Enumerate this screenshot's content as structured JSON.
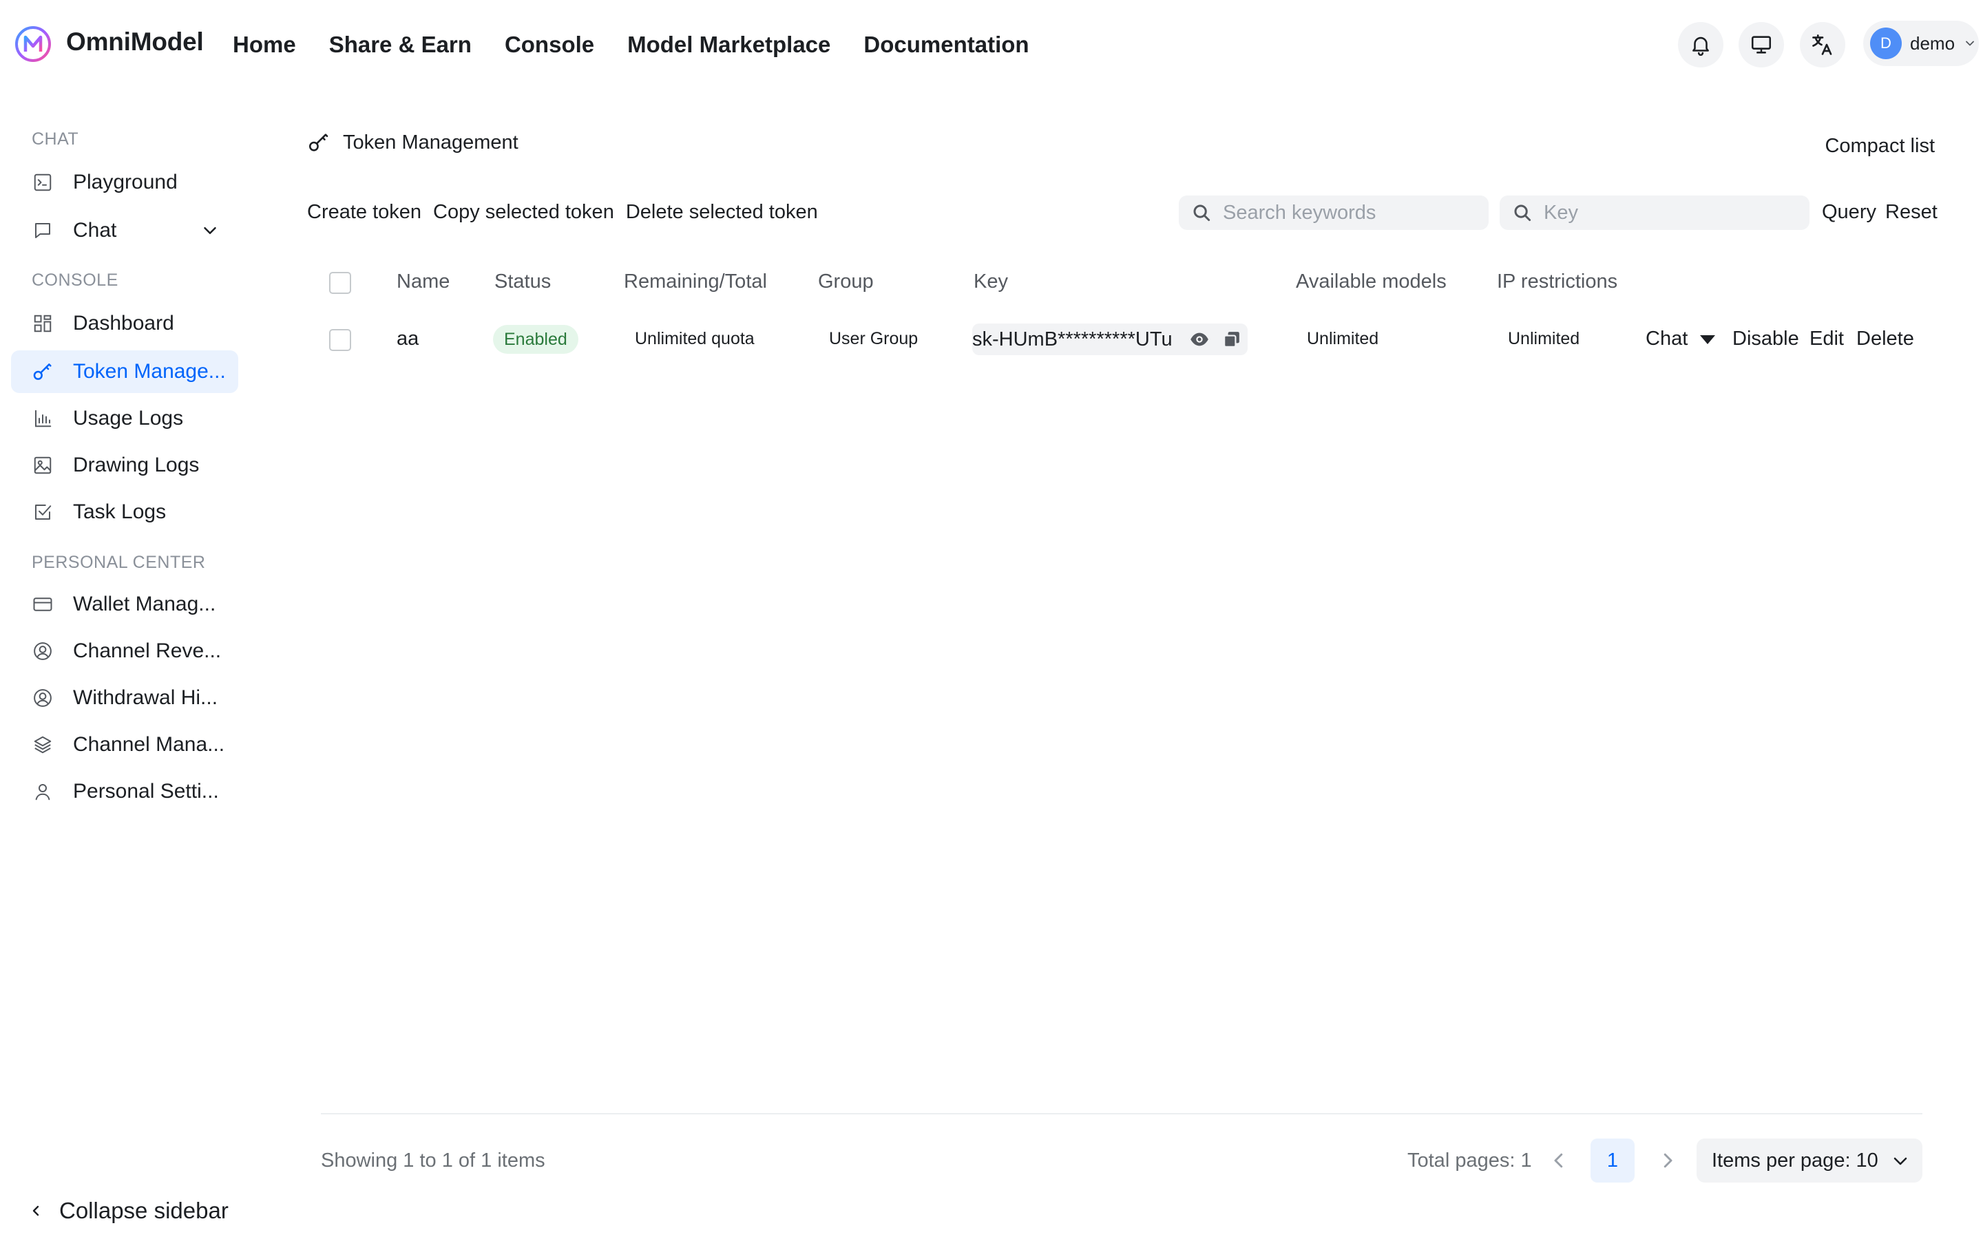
{
  "brand": {
    "name": "OmniModel",
    "logo_icon": "omnimodel-logo-icon"
  },
  "nav": [
    "Home",
    "Share & Earn",
    "Console",
    "Model Marketplace",
    "Documentation"
  ],
  "header_icons": [
    "bell-icon",
    "monitor-icon",
    "translate-icon"
  ],
  "user": {
    "avatar_letter": "D",
    "name": "demo"
  },
  "sidebar": {
    "sections": {
      "chat": "CHAT",
      "console": "CONSOLE",
      "personal": "PERSONAL CENTER"
    },
    "chat_items": [
      {
        "label": "Playground",
        "icon": "terminal-icon"
      },
      {
        "label": "Chat",
        "icon": "chat-bubble-icon"
      }
    ],
    "console_items": [
      {
        "label": "Dashboard",
        "icon": "dashboard-icon"
      },
      {
        "label": "Token Manage...",
        "icon": "key-icon",
        "active": true
      },
      {
        "label": "Usage Logs",
        "icon": "bar-chart-icon"
      },
      {
        "label": "Drawing Logs",
        "icon": "image-icon"
      },
      {
        "label": "Task Logs",
        "icon": "checkbox-icon"
      }
    ],
    "personal_items": [
      {
        "label": "Wallet Manag...",
        "icon": "credit-card-icon"
      },
      {
        "label": "Channel Reve...",
        "icon": "user-circle-icon"
      },
      {
        "label": "Withdrawal Hi...",
        "icon": "user-circle-icon"
      },
      {
        "label": "Channel Mana...",
        "icon": "layers-icon"
      },
      {
        "label": "Personal Setti...",
        "icon": "user-icon"
      }
    ],
    "collapse_label": "Collapse sidebar"
  },
  "page": {
    "title": "Token Management",
    "compact_label": "Compact list",
    "actions": [
      "Create token",
      "Copy selected token",
      "Delete selected token"
    ],
    "search_keywords_placeholder": "Search keywords",
    "search_key_placeholder": "Key",
    "query_label": "Query",
    "reset_label": "Reset"
  },
  "table": {
    "columns": [
      "Name",
      "Status",
      "Remaining/Total",
      "Group",
      "Key",
      "Available models",
      "IP restrictions"
    ],
    "rows": [
      {
        "name": "aa",
        "status": "Enabled",
        "remaining": "Unlimited quota",
        "group": "User Group",
        "key": "sk-HUmB**********UTu",
        "models": "Unlimited",
        "ip": "Unlimited",
        "actions": {
          "chat": "Chat",
          "disable": "Disable",
          "edit": "Edit",
          "delete": "Delete"
        }
      }
    ]
  },
  "pagination": {
    "showing": "Showing 1 to 1 of 1 items",
    "total_pages": "Total pages: 1",
    "current_page": "1",
    "per_page": "Items per page: 10"
  },
  "colors": {
    "accent": "#0064fa",
    "active_bg": "#eaf2fe",
    "badge_bg": "#e5f6ea",
    "badge_text": "#2a7a3b"
  }
}
